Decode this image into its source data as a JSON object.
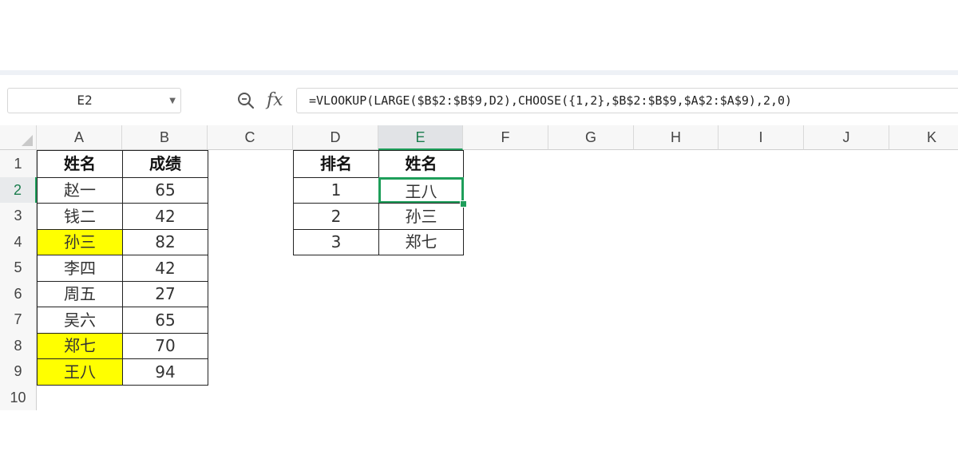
{
  "toolbar": {
    "name_box": "E2",
    "formula": "=VLOOKUP(LARGE($B$2:$B$9,D2),CHOOSE({1,2},$B$2:$B$9,$A$2:$A$9),2,0)",
    "fx_label": "fx"
  },
  "columns": [
    "A",
    "B",
    "C",
    "D",
    "E",
    "F",
    "G",
    "H",
    "I",
    "J",
    "K"
  ],
  "rows": [
    "1",
    "2",
    "3",
    "4",
    "5",
    "6",
    "7",
    "8",
    "9",
    "10"
  ],
  "table1": {
    "headers": [
      "姓名",
      "成绩"
    ],
    "rows": [
      {
        "name": "赵一",
        "score": "65",
        "highlight": false
      },
      {
        "name": "钱二",
        "score": "42",
        "highlight": false
      },
      {
        "name": "孙三",
        "score": "82",
        "highlight": true
      },
      {
        "name": "李四",
        "score": "42",
        "highlight": false
      },
      {
        "name": "周五",
        "score": "27",
        "highlight": false
      },
      {
        "name": "吴六",
        "score": "65",
        "highlight": false
      },
      {
        "name": "郑七",
        "score": "70",
        "highlight": true
      },
      {
        "name": "王八",
        "score": "94",
        "highlight": true
      }
    ]
  },
  "table2": {
    "headers": [
      "排名",
      "姓名"
    ],
    "rows": [
      {
        "rank": "1",
        "name": "王八"
      },
      {
        "rank": "2",
        "name": "孙三"
      },
      {
        "rank": "3",
        "name": "郑七"
      }
    ]
  },
  "colors": {
    "highlight": "#ffff00",
    "selection": "#1e9e5a"
  }
}
